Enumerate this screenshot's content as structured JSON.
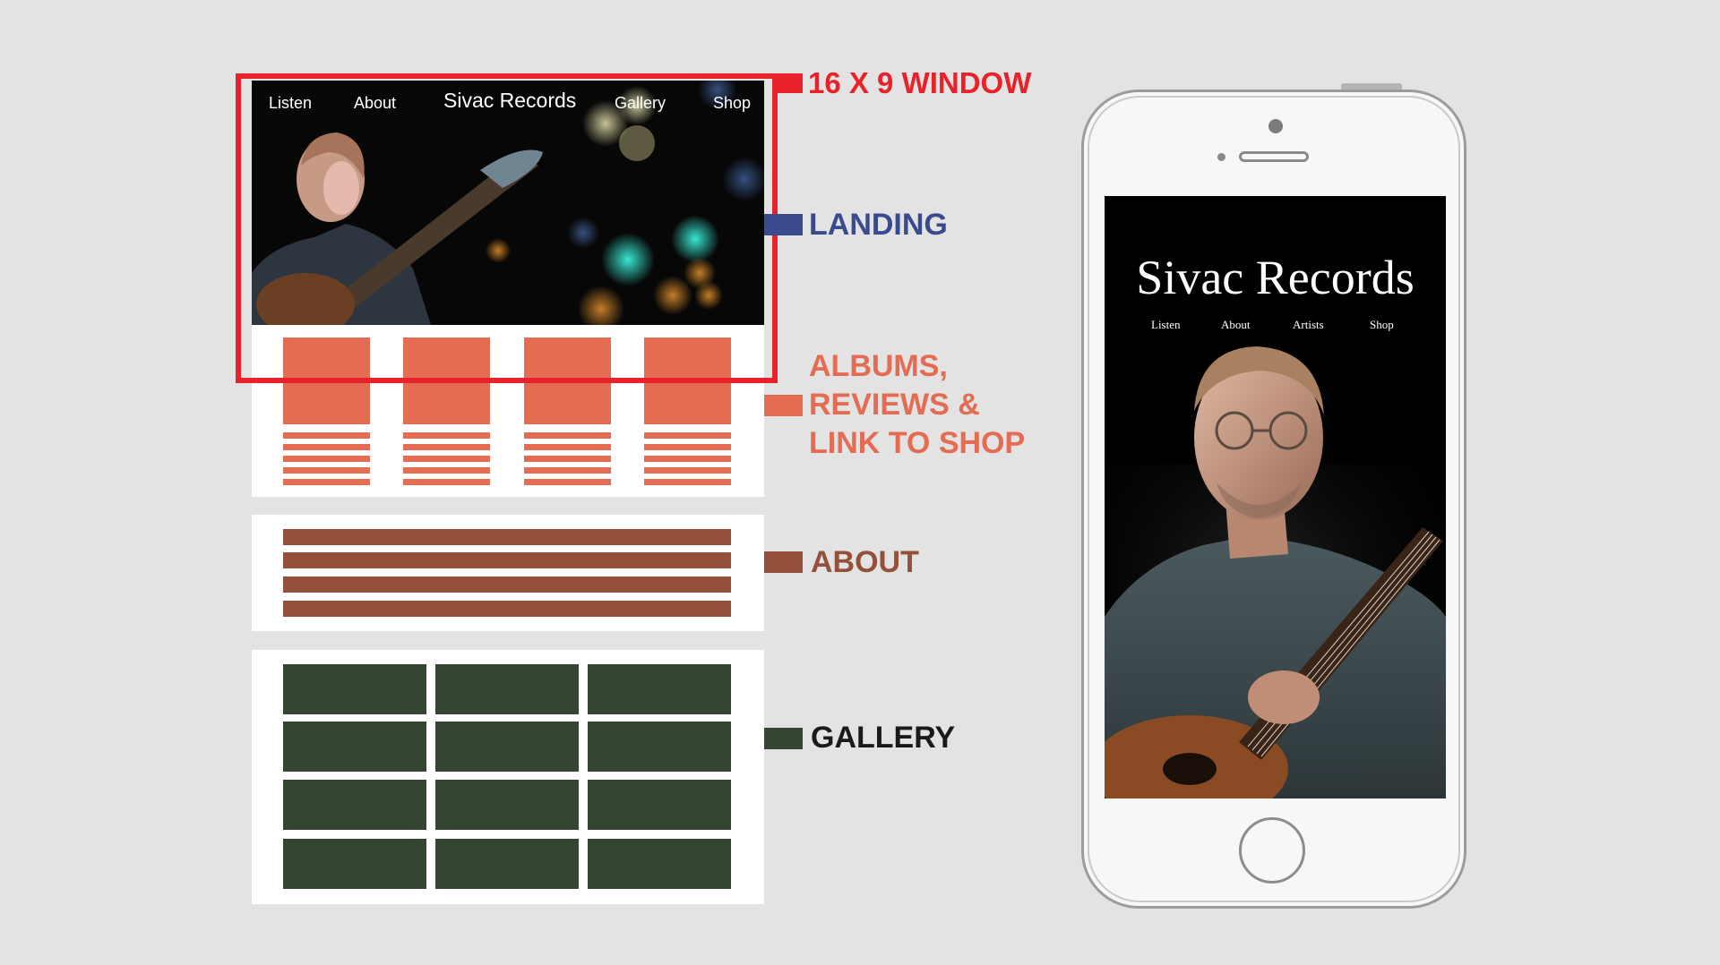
{
  "desktop": {
    "nav": {
      "listen": "Listen",
      "about": "About",
      "title": "Sivac Records",
      "gallery": "Gallery",
      "shop": "Shop"
    }
  },
  "labels": {
    "window": "16 X 9 WINDOW",
    "landing": "LANDING",
    "albums": "ALBUMS,\nREVIEWS &\nLINK TO SHOP",
    "about": "ABOUT",
    "gallery": "GALLERY"
  },
  "mobile": {
    "title": "Sivac Records",
    "nav": [
      "Listen",
      "About",
      "Artists",
      "Shop"
    ]
  },
  "colors": {
    "window": "#e8222a",
    "landing": "#3a4a8f",
    "albums": "#e36c53",
    "about": "#93513b",
    "gallery": "#344532",
    "gallery_label": "#1a1a1a"
  },
  "wireframe": {
    "album_columns": 4,
    "album_lines_per_column": 5,
    "about_lines": 4,
    "gallery_rows": 4,
    "gallery_cols": 3
  }
}
